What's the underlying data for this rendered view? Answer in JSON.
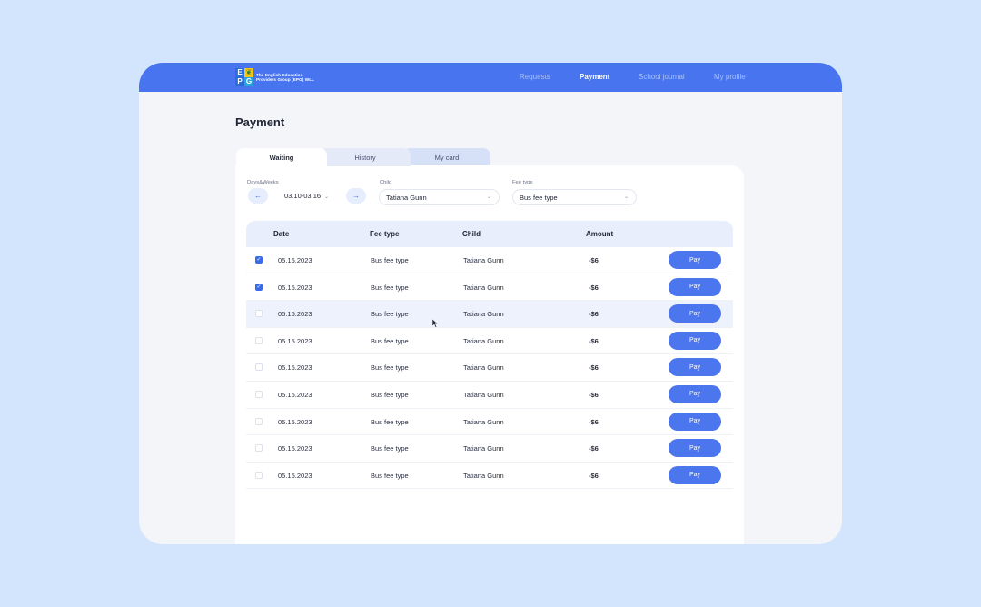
{
  "topbar": {
    "logo_letters": [
      "E",
      "",
      "P",
      "G"
    ],
    "logo_text_line1": "The English Education",
    "logo_text_line2": "Providers Group (EPG) WLL",
    "nav": [
      {
        "label": "Requests",
        "active": false
      },
      {
        "label": "Payment",
        "active": true
      },
      {
        "label": "School journal",
        "active": false
      },
      {
        "label": "My profile",
        "active": false
      }
    ]
  },
  "page": {
    "title": "Payment"
  },
  "tabs": [
    {
      "label": "Waiting",
      "active": true
    },
    {
      "label": "History",
      "active": false
    },
    {
      "label": "My card",
      "active": false
    }
  ],
  "filters": {
    "week_label": "Days&Weeks",
    "week_value": "03.10-03.16",
    "child_label": "Child",
    "child_value": "Tatiana Gunn",
    "fee_label": "Fee type",
    "fee_value": "Bus fee type"
  },
  "table": {
    "headers": [
      "Date",
      "Fee type",
      "Child",
      "Amount"
    ],
    "pay_label": "Pay",
    "rows": [
      {
        "checked": true,
        "date": "05.15.2023",
        "fee": "Bus fee type",
        "child": "Tatiana Gunn",
        "amount": "-$6"
      },
      {
        "checked": true,
        "date": "05.15.2023",
        "fee": "Bus fee type",
        "child": "Tatiana Gunn",
        "amount": "-$6"
      },
      {
        "checked": false,
        "date": "05.15.2023",
        "fee": "Bus fee type",
        "child": "Tatiana Gunn",
        "amount": "-$6"
      },
      {
        "checked": false,
        "date": "05.15.2023",
        "fee": "Bus fee type",
        "child": "Tatiana Gunn",
        "amount": "-$6"
      },
      {
        "checked": false,
        "date": "05.15.2023",
        "fee": "Bus fee type",
        "child": "Tatiana Gunn",
        "amount": "-$6"
      },
      {
        "checked": false,
        "date": "05.15.2023",
        "fee": "Bus fee type",
        "child": "Tatiana Gunn",
        "amount": "-$6"
      },
      {
        "checked": false,
        "date": "05.15.2023",
        "fee": "Bus fee type",
        "child": "Tatiana Gunn",
        "amount": "-$6"
      },
      {
        "checked": false,
        "date": "05.15.2023",
        "fee": "Bus fee type",
        "child": "Tatiana Gunn",
        "amount": "-$6"
      },
      {
        "checked": false,
        "date": "05.15.2023",
        "fee": "Bus fee type",
        "child": "Tatiana Gunn",
        "amount": "-$6"
      }
    ]
  },
  "colors": {
    "accent": "#4874f0",
    "background": "#d3e5fc",
    "pay_button": "#4b76ee"
  }
}
